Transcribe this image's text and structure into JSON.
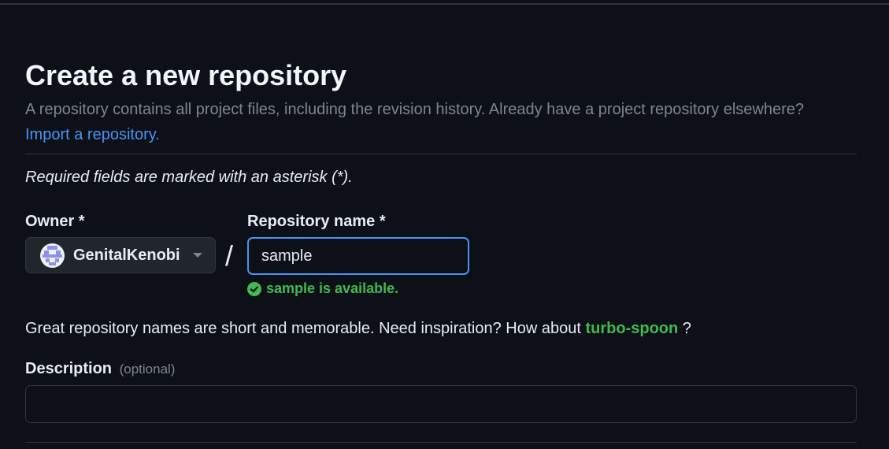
{
  "page": {
    "title": "Create a new repository",
    "subtitle": "A repository contains all project files, including the revision history. Already have a project repository elsewhere?",
    "import_link": "Import a repository.",
    "required_note": "Required fields are marked with an asterisk (*)."
  },
  "owner": {
    "label": "Owner *",
    "selected": "GenitalKenobi",
    "icon": "chevron-down-icon"
  },
  "separator": "/",
  "repository": {
    "label": "Repository name *",
    "value": "sample",
    "availability": "sample is available.",
    "status_color": "#3fb950",
    "focus_color": "#4493f8"
  },
  "suggestion": {
    "prefix": "Great repository names are short and memorable. Need inspiration? How about",
    "name": "turbo-spoon",
    "suffix": "?"
  },
  "description": {
    "label": "Description",
    "optional": "(optional)",
    "value": ""
  }
}
